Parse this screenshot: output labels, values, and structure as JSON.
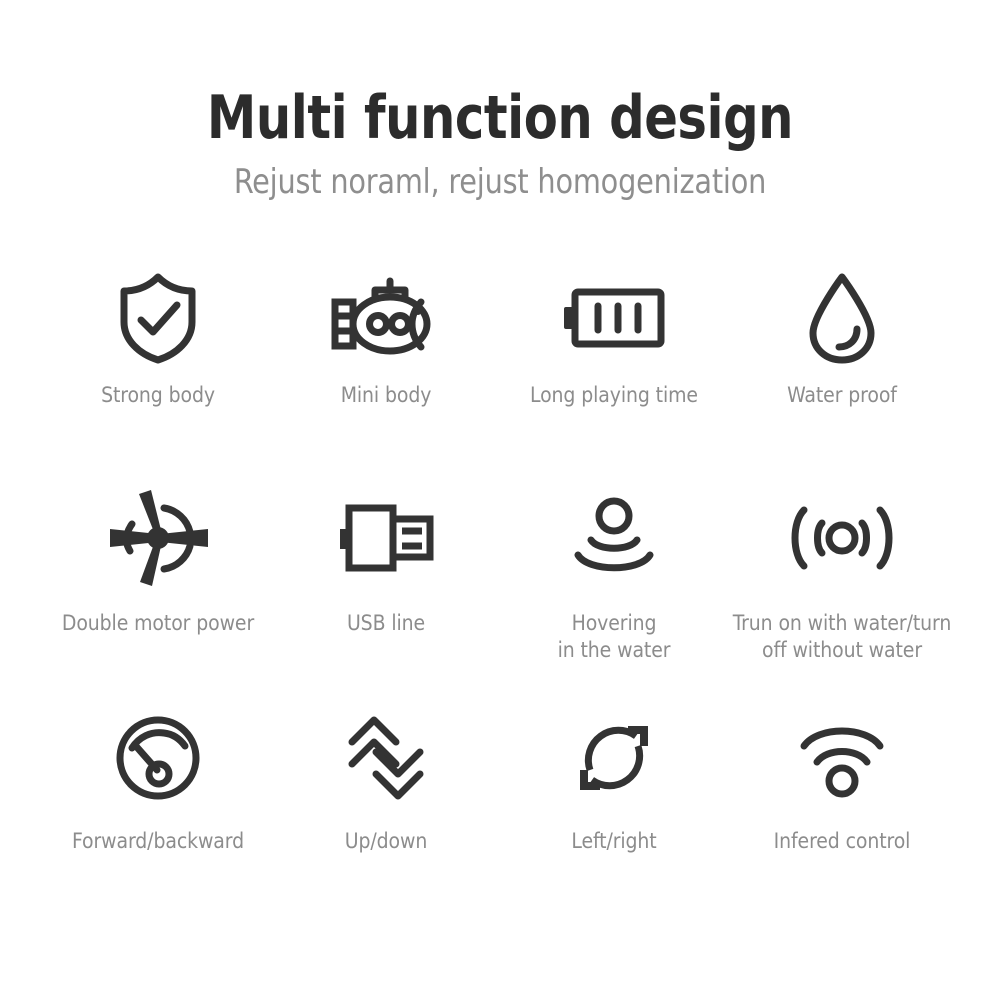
{
  "header": {
    "title": "Multi function design",
    "subtitle": "Rejust noraml, rejust homogenization"
  },
  "colors": {
    "background": "#ffffff",
    "title_text": "#2c2c2c",
    "subtitle_text": "#8e8e8e",
    "label_text": "#8c8c8c",
    "icon_stroke": "#333333"
  },
  "features": [
    {
      "icon": "shield-check-icon",
      "label": "Strong body"
    },
    {
      "icon": "submarine-icon",
      "label": "Mini body"
    },
    {
      "icon": "battery-icon",
      "label": "Long playing time"
    },
    {
      "icon": "water-drop-icon",
      "label": "Water proof"
    },
    {
      "icon": "propeller-icon",
      "label": "Double motor power"
    },
    {
      "icon": "usb-connector-icon",
      "label": "USB line"
    },
    {
      "icon": "hovering-waves-icon",
      "label": "Hovering\nin the water"
    },
    {
      "icon": "signal-waves-icon",
      "label": "Trun on with water/turn\noff without water"
    },
    {
      "icon": "speedometer-icon",
      "label": "Forward/backward"
    },
    {
      "icon": "double-chevron-up-down-icon",
      "label": "Up/down"
    },
    {
      "icon": "rotate-refresh-icon",
      "label": "Left/right"
    },
    {
      "icon": "wifi-infrared-icon",
      "label": "Infered control"
    }
  ]
}
